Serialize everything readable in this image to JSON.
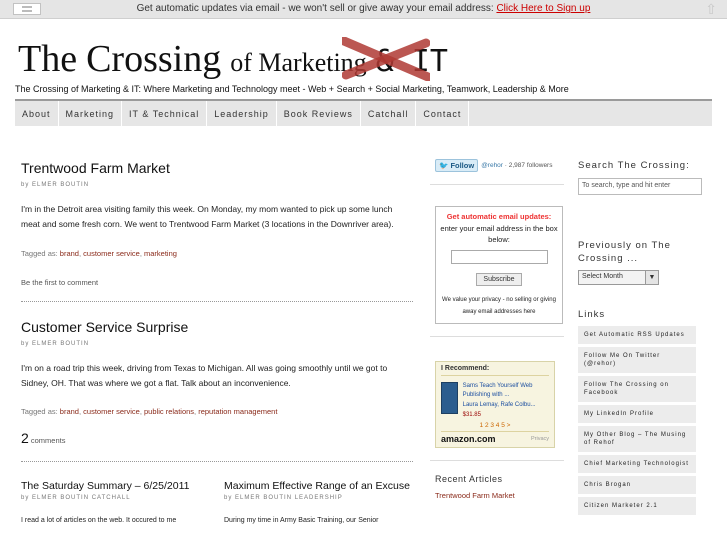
{
  "topbar": {
    "message": "Get automatic updates via email - we won't sell or give away your email address: ",
    "link": "Click Here to Sign up"
  },
  "header": {
    "title_the": "The",
    "title_crossing": "Crossing",
    "title_of_marketing": "of Marketing",
    "title_it": "& IT",
    "tagline": "The Crossing of Marketing & IT: Where Marketing and Technology meet - Web + Search + Social Marketing, Teamwork, Leadership & More"
  },
  "nav": {
    "items": [
      "About",
      "Marketing",
      "IT & Technical",
      "Leadership",
      "Book Reviews",
      "Catchall",
      "Contact"
    ]
  },
  "posts": [
    {
      "title": "Trentwood Farm Market",
      "by": "by",
      "author": "ELMER BOUTIN",
      "excerpt": "I'm in the Detroit area visiting family this week. On Monday, my mom wanted to pick up some lunch meat and some fresh corn. We went to Trentwood Farm Market (3 locations in the Downriver area).",
      "tagged_label": "Tagged as:",
      "tags": [
        "brand",
        "customer service",
        "marketing"
      ],
      "comments": "Be the first to comment"
    },
    {
      "title": "Customer Service Surprise",
      "by": "by",
      "author": "ELMER BOUTIN",
      "excerpt": "I'm on a road trip this week, driving from Texas to Michigan. All was going smoothly until we got to Sidney, OH. That was where we got a flat. Talk about an inconvenience.",
      "tagged_label": "Tagged as:",
      "tags": [
        "brand",
        "customer service",
        "public relations",
        "reputation management"
      ],
      "comment_count": "2",
      "comments_label": "comments"
    }
  ],
  "mini_posts": [
    {
      "title": "The Saturday Summary – 6/25/2011",
      "by": "by",
      "author": "ELMER BOUTIN",
      "category": "CATCHALL",
      "excerpt": "I read a lot of articles on the web. It occured to me"
    },
    {
      "title": "Maximum Effective Range of an Excuse",
      "by": "by",
      "author": "ELMER BOUTIN",
      "category": "LEADERSHIP",
      "excerpt": "During my time in Army Basic Training, our Senior"
    }
  ],
  "center": {
    "follow_label": "Follow",
    "follow_icon": "twitter-bird-icon",
    "handle": "@rehor",
    "followers": "2,987 followers",
    "email_heading": "Get automatic email updates:",
    "email_text": "enter your email address in the box below:",
    "subscribe": "Subscribe",
    "privacy_note": "We value your privacy - no selling or giving away email addresses here",
    "amazon_heading": "I Recommend:",
    "book_title": "Sams Teach Yourself Web Publishing with ...",
    "book_author": "Laura Lemay, Rafe Colbu...",
    "book_price": "$31.85",
    "pages": "1 2 3 4 5 >",
    "amazon_logo": "amazon.com",
    "amazon_privacy": "Privacy",
    "recent_heading": "Recent Articles",
    "recent_items": [
      "Trentwood Farm Market"
    ]
  },
  "sidebar": {
    "search_heading": "Search The Crossing:",
    "search_placeholder": "To search, type and hit enter",
    "previously_heading": "Previously on The Crossing ...",
    "select_value": "Select Month",
    "links_heading": "Links",
    "links": [
      "Get Automatic RSS Updates",
      "Follow Me On Twitter (@rehor)",
      "Follow The Crossing on Facebook",
      "My LinkedIn Profile",
      "My Other Blog – The Musing of Rehof",
      "Chief Marketing Technologist",
      "Chris Brogan",
      "Citizen Marketer 2.1"
    ]
  }
}
